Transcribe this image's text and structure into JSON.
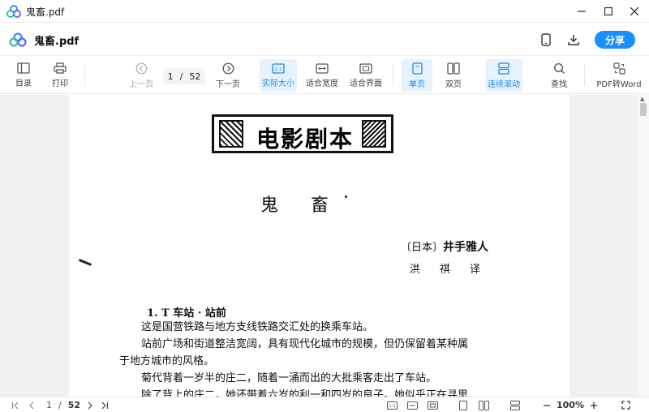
{
  "window": {
    "title": "鬼畜.pdf"
  },
  "header": {
    "doc_name": "鬼畜.pdf",
    "share_label": "分享"
  },
  "toolbar": {
    "toc": "目录",
    "print": "打印",
    "prev": "上一页",
    "page_current": "1",
    "page_sep": "/",
    "page_total": "52",
    "next": "下一页",
    "actual_size": "实际大小",
    "fit_width": "适合宽度",
    "fit_page": "适合界面",
    "single": "单页",
    "double": "双页",
    "continuous": "连续滚动",
    "find": "查找",
    "pdf_to_word": "PDF转Word"
  },
  "document": {
    "stamp_text": "电影剧本",
    "title": "鬼畜",
    "author_prefix": "〔日本〕",
    "author_name": "井手雅人",
    "translator": "洪 祺 译",
    "section_heading": "1. T 车站 · 站前",
    "paragraphs": [
      "这是国营铁路与地方支线铁路交汇处的换乘车站。",
      "站前广场和街道整洁宽阔，具有现代化城市的规模，但仍保留着某种属",
      "于地方城市的风格。",
      "菊代背着一岁半的庄二，随着一涌而出的大批乘客走出了车站。",
      "除了背上的庄二，她还带着六岁的利一和四岁的良子。她似乎正在寻思"
    ]
  },
  "status": {
    "page_current": "1",
    "page_sep": "/",
    "page_total": "52",
    "zoom": "100%"
  },
  "colors": {
    "accent": "#1890ff",
    "active_bg": "#e6f3ff"
  }
}
